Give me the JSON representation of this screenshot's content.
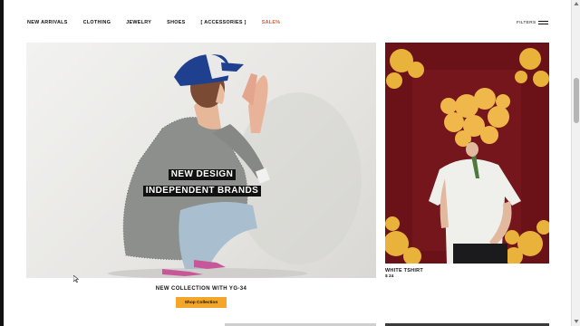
{
  "nav": {
    "items": [
      {
        "label": "NEW ARRIVALS"
      },
      {
        "label": "CLOTHING"
      },
      {
        "label": "JEWELRY"
      },
      {
        "label": "SHOES"
      },
      {
        "label": "[ ACCESSORIES ]"
      },
      {
        "label": "SALE%"
      }
    ],
    "filters_label": "FILTERS",
    "menu_icon": "hamburger-icon"
  },
  "hero": {
    "headline_line1": "NEW DESIGN",
    "headline_line2": "INDEPENDENT BRANDS",
    "collection_title": "NEW COLLECTION WITH YG-34",
    "cta_label": "Shop Collection"
  },
  "product": {
    "name": "WHITE TSHIRT",
    "price": "$ 24"
  },
  "colors": {
    "sale": "#e4572e",
    "cta": "#f4a62a",
    "product_bg": "#6e1318"
  }
}
